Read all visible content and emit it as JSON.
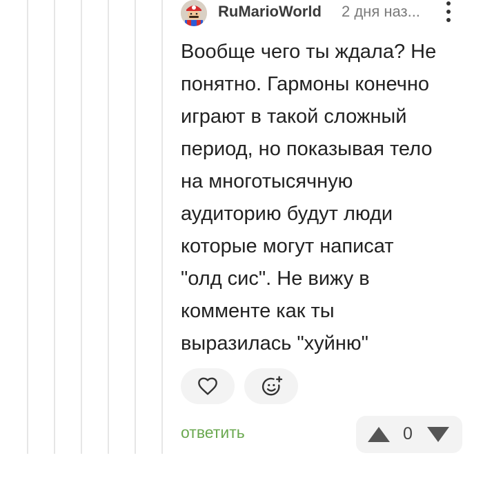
{
  "comment": {
    "author": "RuMarioWorld",
    "timestamp": "2 дня наз...",
    "avatar_icon": "mario-avatar",
    "text_lines": [
      "Вообще чего ты ждала? Не",
      "понятно. Гармоны конечно",
      "играют в такой сложный",
      "период, но показывая тело",
      "на многотысячную",
      "аудиторию будут люди",
      "которые могут написат",
      "\"олд сис\". Не вижу в",
      "комменте как ты",
      "выразилась \"хуйню\""
    ],
    "reply_label": "ответить",
    "vote_count": "0",
    "icons": {
      "menu": "more-vertical-icon",
      "like": "heart-outline-icon",
      "react": "add-emoji-icon",
      "upvote": "triangle-up-icon",
      "downvote": "triangle-down-icon"
    }
  },
  "colors": {
    "reply_link": "#6aa84f",
    "pill_background": "#f3f3f3",
    "thread_line": "#e6e6e6",
    "icon": "#333333",
    "vote_arrow": "#555555"
  }
}
